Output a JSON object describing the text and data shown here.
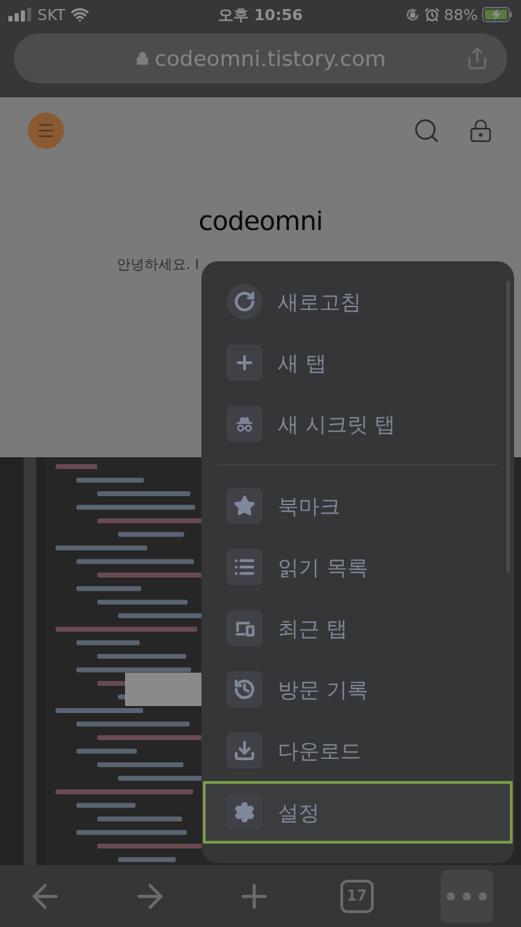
{
  "status_bar": {
    "carrier": "SKT",
    "time": "오후 10:56",
    "battery": "88%"
  },
  "address_bar": {
    "url": "codeomni.tistory.com"
  },
  "page": {
    "title": "codeomni",
    "subtitle": "안녕하세요. I"
  },
  "menu": {
    "groups": [
      [
        {
          "label": "새로고침",
          "selected": false
        },
        {
          "label": "새 탭",
          "selected": false
        },
        {
          "label": "새 시크릿 탭",
          "selected": false
        }
      ],
      [
        {
          "label": "북마크",
          "selected": false
        },
        {
          "label": "읽기 목록",
          "selected": false
        },
        {
          "label": "최근 탭",
          "selected": false
        },
        {
          "label": "방문 기록",
          "selected": false
        },
        {
          "label": "다운로드",
          "selected": false
        },
        {
          "label": "설정",
          "selected": true
        }
      ]
    ]
  },
  "toolbar": {
    "tab_count": "17"
  }
}
